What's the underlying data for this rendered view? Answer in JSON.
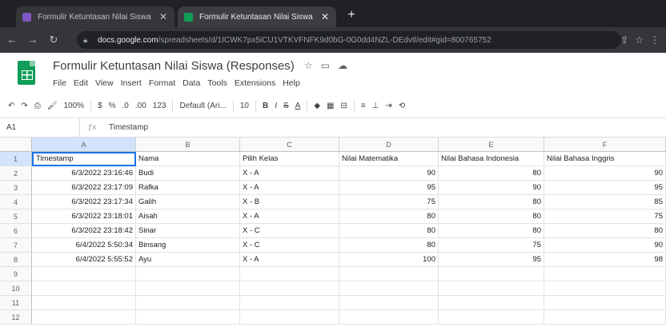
{
  "browser": {
    "tabs": [
      {
        "title": "Formulir Ketuntasan Nilai Siswa",
        "color": "#7e57c2"
      },
      {
        "title": "Formulir Ketuntasan Nilai Siswa",
        "color": "#0f9d58"
      }
    ],
    "new_tab": "+",
    "url_host": "docs.google.com",
    "url_path": "/spreadsheets/d/1tCWK7px5iCU1VTKVFNFK9d0bG-0G0dd4NZL-DEdvtl/edit#gid=800765752"
  },
  "sheet": {
    "title": "Formulir Ketuntasan Nilai Siswa (Responses)",
    "menu": [
      "File",
      "Edit",
      "View",
      "Insert",
      "Format",
      "Data",
      "Tools",
      "Extensions",
      "Help"
    ],
    "format_bar": {
      "zoom": "100%",
      "currency": "$",
      "percent": "%",
      "decimal_dec": ".0",
      "decimal_inc": ".00",
      "number_format": "123",
      "font": "Default (Ari...",
      "font_size": "10",
      "bold": "B",
      "italic": "I",
      "strike": "S",
      "text_color": "A"
    },
    "cell_ref": "A1",
    "formula_value": "Timestamp",
    "columns": [
      "A",
      "B",
      "C",
      "D",
      "E",
      "F"
    ],
    "rows": [
      "1",
      "2",
      "3",
      "4",
      "5",
      "6",
      "7",
      "8",
      "9",
      "10",
      "11",
      "12"
    ],
    "headers": [
      "Timestamp",
      "Nama",
      "Pilih Kelas",
      "Nilai Matematika",
      "Nilai Bahasa Indonesia",
      "Nilai Bahasa Inggris"
    ],
    "data": [
      [
        "6/3/2022 23:16:46",
        "Budi",
        "X - A",
        "90",
        "80",
        "90"
      ],
      [
        "6/3/2022 23:17:09",
        "Rafka",
        "X - A",
        "95",
        "90",
        "95"
      ],
      [
        "6/3/2022 23:17:34",
        "Galih",
        "X - B",
        "75",
        "80",
        "85"
      ],
      [
        "6/3/2022 23:18:01",
        "Aisah",
        "X - A",
        "80",
        "80",
        "75"
      ],
      [
        "6/3/2022 23:18:42",
        "Sinar",
        "X - C",
        "80",
        "80",
        "80"
      ],
      [
        "6/4/2022 5:50:34",
        "Binsang",
        "X - C",
        "80",
        "75",
        "90"
      ],
      [
        "6/4/2022 5:55:52",
        "Ayu",
        "X - A",
        "100",
        "95",
        "98"
      ]
    ]
  }
}
